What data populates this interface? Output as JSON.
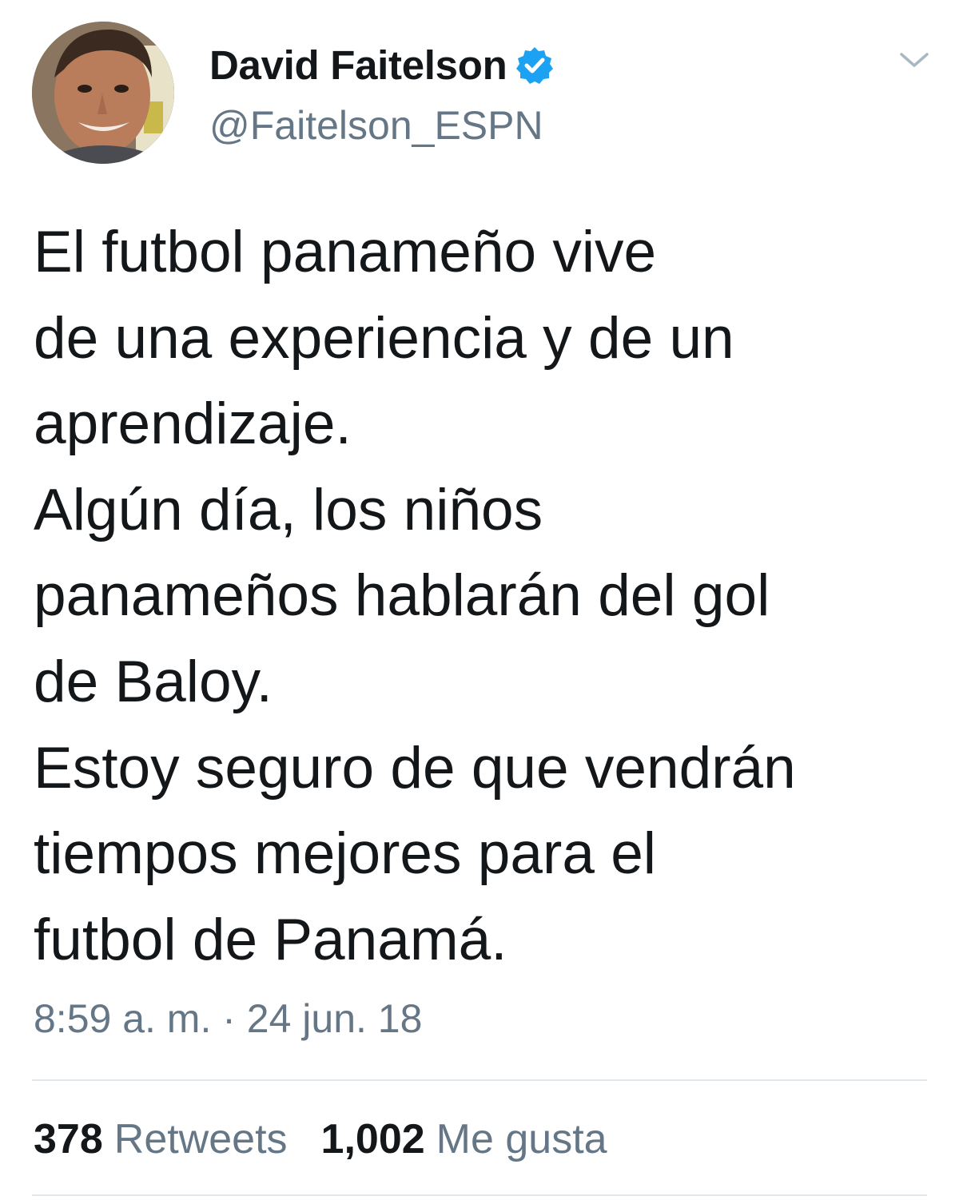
{
  "tweet": {
    "author": {
      "display_name": "David Faitelson",
      "handle": "@Faitelson_ESPN",
      "verified": true,
      "verified_color": "#1da1f2",
      "avatar_icon": "profile-photo"
    },
    "text_lines": [
      "El futbol panameño vive",
      "de una experiencia y de un",
      "aprendizaje.",
      "Algún día, los niños",
      "panameños hablarán del gol",
      "de Baloy.",
      "Estoy seguro de que vendrán",
      "tiempos mejores para el",
      "futbol de Panamá."
    ],
    "timestamp": "8:59 a. m. · 24 jun. 18",
    "stats": {
      "retweets_count": "378",
      "retweets_label": "Retweets",
      "likes_count": "1,002",
      "likes_label": "Me gusta"
    },
    "menu_icon": "chevron-down-icon"
  },
  "colors": {
    "text_primary": "#14171a",
    "text_secondary": "#657786",
    "divider": "#e1e8ed"
  }
}
